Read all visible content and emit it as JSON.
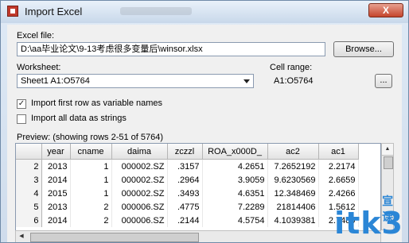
{
  "window": {
    "title": "Import Excel",
    "close_label": "X"
  },
  "excel_file": {
    "label": "Excel file:",
    "value": "D:\\aa毕业论文\\9-13考虑很多变量后\\winsor.xlsx",
    "browse_label": "Browse..."
  },
  "worksheet": {
    "label": "Worksheet:",
    "selected": "Sheet1 A1:O5764"
  },
  "cell_range": {
    "label": "Cell range:",
    "value": "A1:O5764",
    "more_label": "..."
  },
  "options": [
    {
      "label": "Import first row as variable names",
      "checked": true
    },
    {
      "label": "Import all data as strings",
      "checked": false
    }
  ],
  "preview": {
    "label": "Preview: (showing rows 2-51 of 5764)",
    "columns": [
      "year",
      "cname",
      "daima",
      "zczzl",
      "ROA_x000D_",
      "ac2",
      "ac1"
    ],
    "rows": [
      [
        "2",
        "2013",
        "1",
        "000002.SZ",
        ".3157",
        "4.2651",
        "7.2652192",
        "2.2174"
      ],
      [
        "3",
        "2014",
        "1",
        "000002.SZ",
        ".2964",
        "3.9059",
        "9.6230569",
        "2.6659"
      ],
      [
        "4",
        "2015",
        "1",
        "000002.SZ",
        ".3493",
        "4.6351",
        "12.348469",
        "2.4266"
      ],
      [
        "5",
        "2013",
        "2",
        "000006.SZ",
        ".4775",
        "7.2289",
        "21814406",
        "1.5612"
      ],
      [
        "6",
        "2014",
        "2",
        "000006.SZ",
        ".2144",
        "4.5754",
        "4.1039381",
        "2.7489"
      ]
    ]
  },
  "watermark": {
    "text": "itk3",
    "sub": "宣课"
  }
}
